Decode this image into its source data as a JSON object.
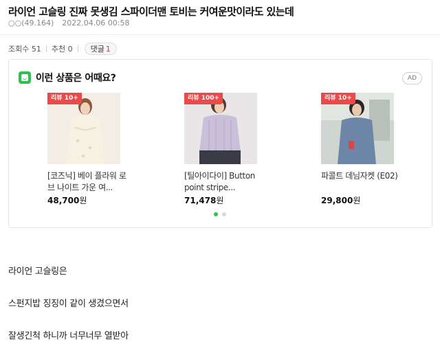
{
  "post": {
    "title": "라이언 고슬링 진짜 못생김 스파이더맨 토비는 커여운맛이라도 있는데",
    "author": "○○(49.164)",
    "date": "2022.04.06 00:58",
    "views_label": "조회수 51",
    "recommend_label": "추천 0",
    "comment_label": "댓글",
    "comment_count": "1"
  },
  "ad": {
    "heading": "이런 상품은 어때요?",
    "badge": "AD",
    "active_page": 1,
    "page_count": 2,
    "products": [
      {
        "badge": "리뷰 10+",
        "name": "[코즈닉] 베이 플라워 로브 나이트 가운 여...",
        "price": "48,700",
        "unit": "원"
      },
      {
        "badge": "리뷰 100+",
        "name": "[틸아이다이] Button point stripe...",
        "price": "71,478",
        "unit": "원"
      },
      {
        "badge": "리뷰 10+",
        "name": "파콜트 데님자켓 (E02)",
        "price": "29,800",
        "unit": "원"
      }
    ]
  },
  "content": {
    "lines": [
      "라이언 고슬링은",
      "스펀지밥 징징이 같이 생겼으면서",
      "잘생긴척 하니까 너무너무 열받아"
    ]
  },
  "colors": {
    "accent_green": "#2fc24b",
    "review_badge_red": "#ea4a4a",
    "comment_count_red": "#e53935"
  },
  "icons": {
    "ad_heading_icon": "shopping-icon"
  }
}
